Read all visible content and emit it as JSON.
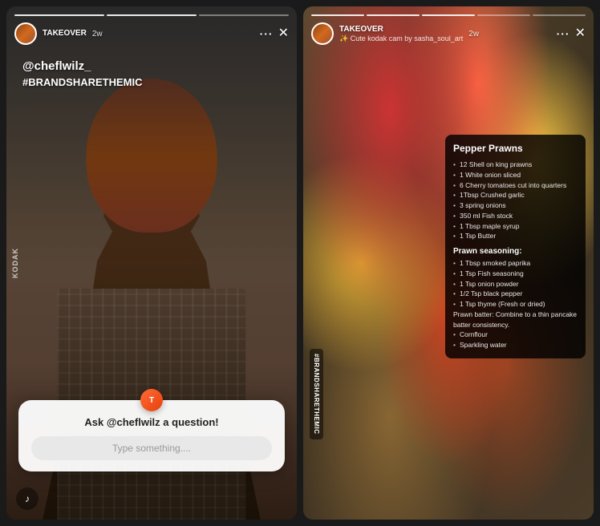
{
  "left_story": {
    "header": {
      "username": "TAKEOVER",
      "time": "2w",
      "progress_segments": 3,
      "active_segment": 1
    },
    "vertical_text": "KODAK",
    "tag": "@cheflwilz_",
    "hashtag": "#BRANDSHARETHEMIC",
    "question_card": {
      "logo_text": "T",
      "title": "Ask @cheflwilz a question!",
      "input_placeholder": "Type something...."
    }
  },
  "right_story": {
    "header": {
      "username": "TAKEOVER",
      "subtitle": "✨ Cute kodak cam by sasha_soul_art",
      "time": "2w",
      "progress_segments": 5,
      "active_segment": 2
    },
    "recipe": {
      "title": "Pepper Prawns",
      "ingredients_label": "",
      "ingredients": [
        "12 Shell on king prawns",
        "1 White onion sliced",
        "6 Cherry tomatoes cut into quarters",
        "1Tbsp Crushed garlic",
        "3 spring onions",
        "350 ml Fish stock",
        "1 Tbsp maple syrup",
        "1 Tsp Butter"
      ],
      "seasoning_label": "Prawn seasoning:",
      "seasoning": [
        "1 Tbsp smoked paprika",
        "1 Tsp Fish seasoning",
        "1 Tsp onion powder",
        "1/2 Tsp black pepper",
        "1 Tsp thyme (Fresh or dried)"
      ],
      "batter_label": "Prawn batter: Combine to a thin pancake batter consistency.",
      "batter": [
        "Cornflour",
        "Sparkling water"
      ]
    },
    "hashtag_sticker": "#BRANDSHARETHEMIC"
  },
  "icons": {
    "dots": "···",
    "close": "✕",
    "mute": "♪"
  }
}
